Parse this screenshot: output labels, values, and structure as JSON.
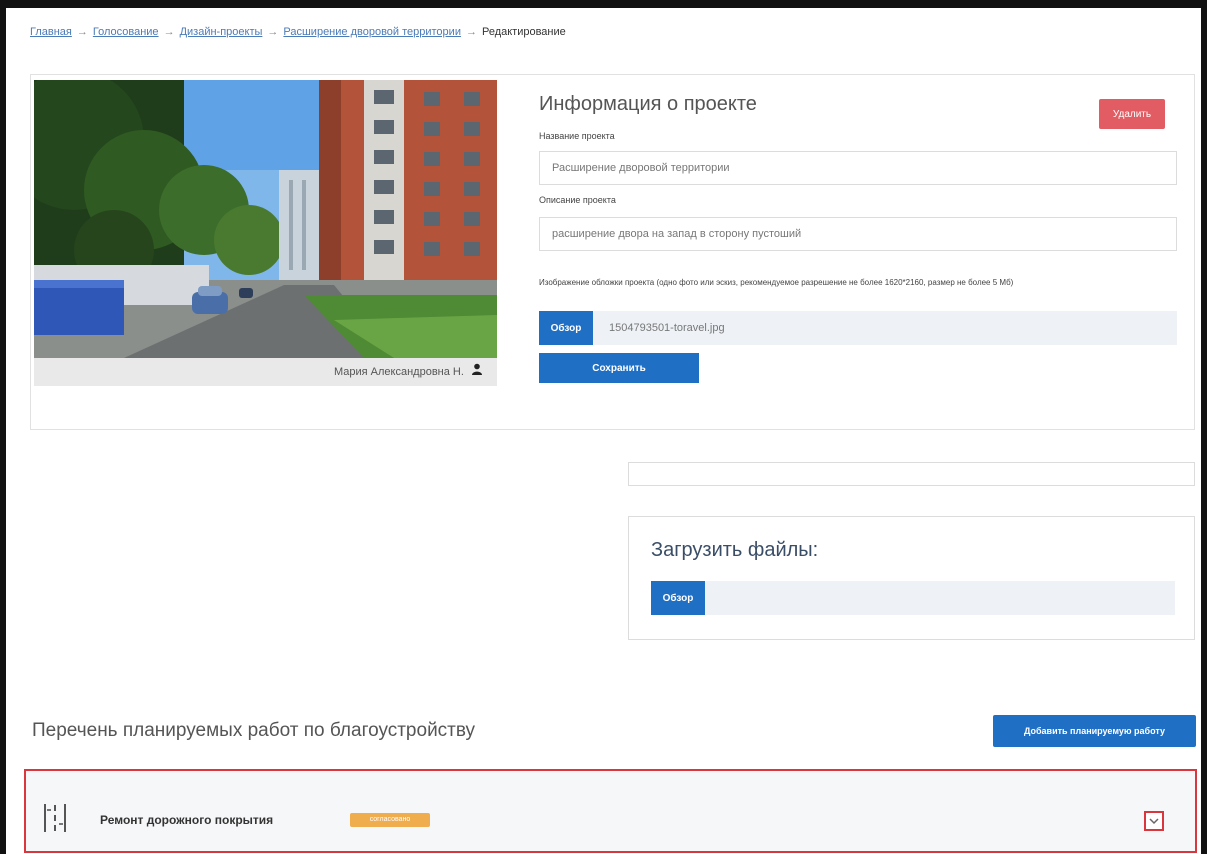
{
  "breadcrumb": {
    "items": [
      "Главная",
      "Голосование",
      "Дизайн-проекты",
      "Расширение дворовой территории"
    ],
    "separator": "→",
    "current": "Редактирование"
  },
  "project": {
    "photo_author": "Мария Александровна Н.",
    "title": "Информация о проекте",
    "delete_label": "Удалить",
    "name_label": "Название проекта",
    "name_value": "Расширение дворовой территории",
    "description_label": "Описание проекта",
    "description_value": "расширение двора на запад в сторону пустоший",
    "image_hint": "Изображение обложки проекта (одно фото или эскиз, рекомендуемое разрешение не более 1620*2160, размер не более 5 Мб)",
    "browse_label": "Обзор",
    "file_name": "1504793501-toravel.jpg",
    "save_label": "Сохранить"
  },
  "upload": {
    "title": "Загрузить файлы:",
    "browse_label": "Обзор"
  },
  "works": {
    "title": "Перечень планируемых работ по благоустройству",
    "add_label": "Добавить планируемую работу",
    "items": [
      {
        "name": "Ремонт дорожного покрытия",
        "badge": "согласовано"
      }
    ]
  },
  "colors": {
    "accent": "#1f6fc5",
    "danger": "#e25d63",
    "highlight_border": "#d9363e",
    "badge": "#f0ad4e"
  }
}
